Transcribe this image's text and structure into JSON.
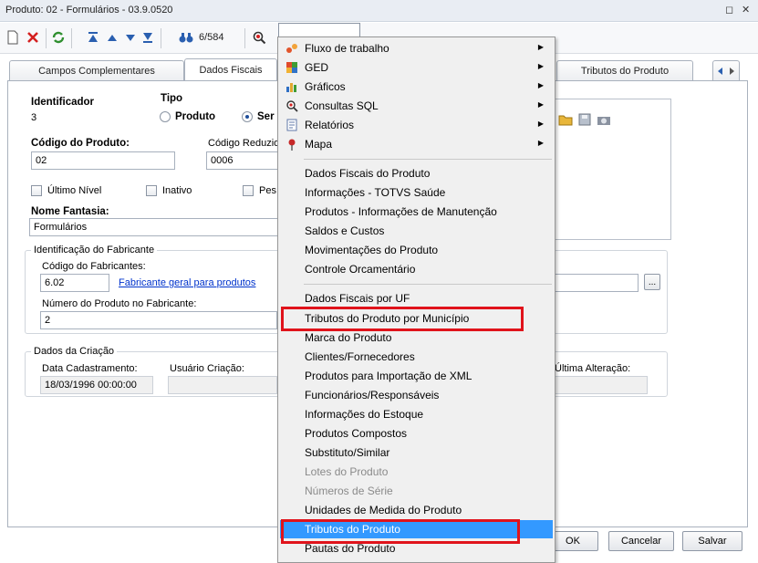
{
  "window": {
    "title": "Produto: 02 - Formulários - 03.9.0520",
    "restore_glyph": "◻",
    "close_glyph": "✕"
  },
  "toolbar": {
    "counter": "6/584"
  },
  "tabs": [
    {
      "label": "Campos Complementares"
    },
    {
      "label": "Dados Fiscais"
    },
    {
      "label": "Tributos do Produto"
    }
  ],
  "form": {
    "identificador_label": "Identificador",
    "identificador_value": "3",
    "tipo_label": "Tipo",
    "tipo_options": [
      "Produto",
      "Ser"
    ],
    "codigo_label": "Código do Produto:",
    "codigo_value": "02",
    "codigo_reduzido_label": "Código Reduzio",
    "codigo_reduzido_value": "0006",
    "chk_ultimo_nivel": "Último Nível",
    "chk_inativo": "Inativo",
    "chk_pes": "Pes",
    "nome_fantasia_label": "Nome Fantasia:",
    "nome_fantasia_value": "Formulários",
    "fabricante_group": "Identificação do Fabricante",
    "cod_fabricante_label": "Código do Fabricantes:",
    "cod_fabricante_value": "6.02",
    "cod_fabricante_link": "Fabricante geral para produtos",
    "numero_fabricante_label": "Número do Produto no Fabricante:",
    "numero_fabricante_value": "2",
    "criacao_group": "Dados da Criação",
    "data_cadastro_label": "Data Cadastramento:",
    "data_cadastro_value": "18/03/1996 00:00:00",
    "usuario_criacao_label": "Usuário Criação:",
    "ultima_alteracao_label": "Última Alteração:",
    "ellipsis": "..."
  },
  "buttons": {
    "ok": "OK",
    "cancelar": "Cancelar",
    "salvar": "Salvar"
  },
  "menu": {
    "submenus": [
      {
        "label": "Fluxo de trabalho",
        "icon": "workflow-icon"
      },
      {
        "label": "GED",
        "icon": "ged-icon"
      },
      {
        "label": "Gráficos",
        "icon": "chart-icon"
      },
      {
        "label": "Consultas SQL",
        "icon": "sql-query-icon"
      },
      {
        "label": "Relatórios",
        "icon": "report-icon"
      },
      {
        "label": "Mapa",
        "icon": "map-pin-icon"
      }
    ],
    "group1": [
      "Dados Fiscais do Produto",
      "Informações - TOTVS Saúde",
      "Produtos - Informações de Manutenção",
      "Saldos e Custos",
      "Movimentações do Produto",
      "Controle Orcamentário"
    ],
    "group2": [
      "Dados Fiscais por UF",
      "Tributos do Produto por Município",
      "Marca do Produto",
      "Clientes/Fornecedores",
      "Produtos para Importação de XML",
      "Funcionários/Responsáveis",
      "Informações do Estoque",
      "Produtos Compostos",
      "Substituto/Similar",
      "Lotes do Produto",
      "Números de Série",
      "Unidades de Medida do Produto",
      "Tributos do Produto",
      "Pautas do Produto"
    ],
    "highlight_color": "#3399ff",
    "annotation_color": "#e0131b"
  }
}
